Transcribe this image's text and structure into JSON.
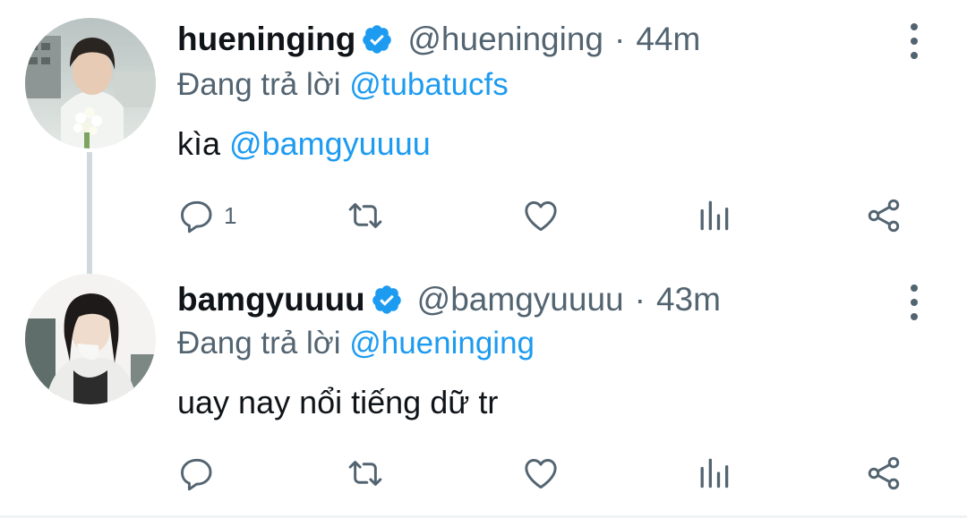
{
  "tweets": [
    {
      "display_name": "hueninging",
      "handle": "@hueninging",
      "separator": "·",
      "time": "44m",
      "reply_prefix": "Đang trả lời",
      "reply_to": "@tubatucfs",
      "text_prefix": "kìa",
      "text_mention": "@bamgyuuuu",
      "reply_count": "1",
      "avatar_icon": "avatar-photo-boy-with-flowers",
      "verified": true
    },
    {
      "display_name": "bamgyuuuu",
      "handle": "@bamgyuuuu",
      "separator": "·",
      "time": "43m",
      "reply_prefix": "Đang trả lời",
      "reply_to": "@hueninging",
      "text": "uay nay nổi tiếng dữ tr",
      "reply_count": "",
      "avatar_icon": "avatar-photo-girl-white-sweater",
      "verified": true
    }
  ],
  "colors": {
    "link": "#1d9bf0",
    "secondary_text": "#536471",
    "primary_text": "#0f1419",
    "verified_badge": "#1d9bf0",
    "thread_line": "#cfd9de"
  },
  "action_icons": [
    "reply-icon",
    "retweet-icon",
    "like-icon",
    "analytics-icon",
    "share-icon"
  ]
}
